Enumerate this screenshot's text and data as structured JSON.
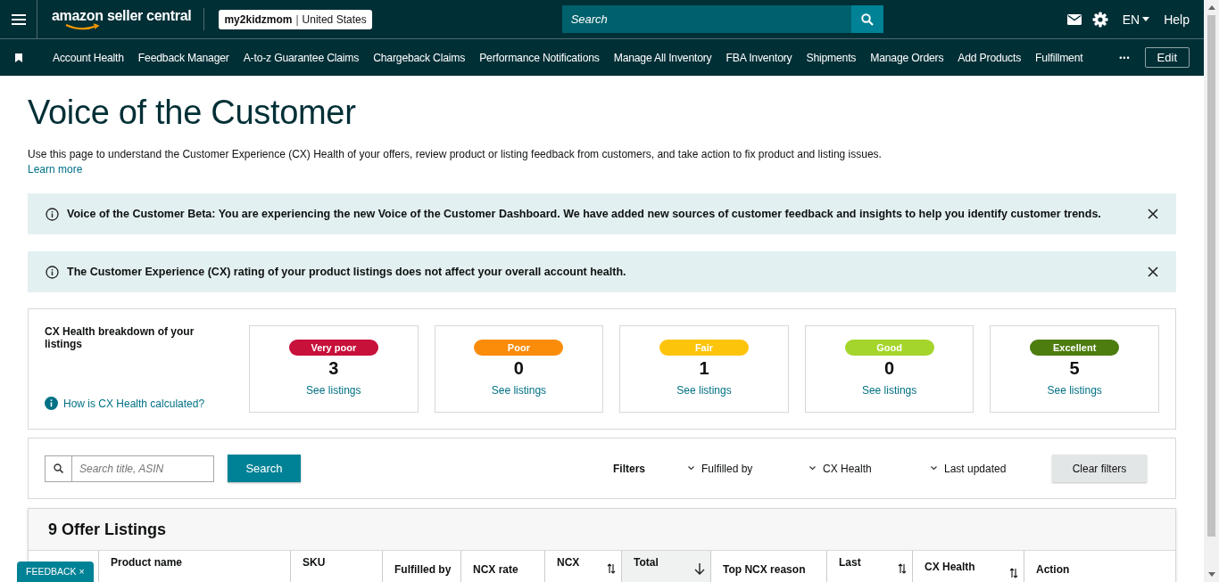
{
  "header": {
    "brand": "amazon seller central",
    "store": {
      "name": "my2kidzmom",
      "separator": "|",
      "region": "United States"
    },
    "search": {
      "placeholder": "Search"
    },
    "language": "EN",
    "help": "Help"
  },
  "nav": {
    "items": [
      "Account Health",
      "Feedback Manager",
      "A-to-z Guarantee Claims",
      "Chargeback Claims",
      "Performance Notifications",
      "Manage All Inventory",
      "FBA Inventory",
      "Shipments",
      "Manage Orders",
      "Add Products",
      "Fulfillment"
    ],
    "more": "•••",
    "edit": "Edit"
  },
  "page": {
    "title": "Voice of the Customer",
    "description": "Use this page to understand the Customer Experience (CX) Health of your offers, review product or listing feedback from customers, and take action to fix product and listing issues.",
    "learn_more": "Learn more"
  },
  "alerts": [
    {
      "text": "Voice of the Customer Beta: You are experiencing the new Voice of the Customer Dashboard. We have added new sources of customer feedback and insights to help you identify customer trends."
    },
    {
      "text": "The Customer Experience (CX) rating of your product listings does not affect your overall account health."
    }
  ],
  "breakdown": {
    "title": "CX Health breakdown of your listings",
    "help_link": "How is CX Health calculated?",
    "tiles": [
      {
        "label": "Very poor",
        "color": "#c7103a",
        "count": "3",
        "link": "See listings"
      },
      {
        "label": "Poor",
        "color": "#fa8c0a",
        "count": "0",
        "link": "See listings"
      },
      {
        "label": "Fair",
        "color": "#fdc40c",
        "count": "1",
        "link": "See listings"
      },
      {
        "label": "Good",
        "color": "#a4d52b",
        "count": "0",
        "link": "See listings"
      },
      {
        "label": "Excellent",
        "color": "#4d7c0f",
        "count": "5",
        "link": "See listings"
      }
    ]
  },
  "filters": {
    "search": {
      "placeholder": "Search title, ASIN"
    },
    "search_button": "Search",
    "label": "Filters",
    "dropdowns": [
      "Fulfilled by",
      "CX Health",
      "Last updated"
    ],
    "clear": "Clear filters"
  },
  "table": {
    "title": "9 Offer Listings",
    "columns": [
      {
        "label": "Product name",
        "sortable": false,
        "sorted": false
      },
      {
        "label": "SKU",
        "sortable": false,
        "sorted": false
      },
      {
        "label": "Fulfilled by",
        "sortable": false,
        "sorted": false
      },
      {
        "label": "NCX rate",
        "sortable": false,
        "sorted": false
      },
      {
        "label": "NCX",
        "sortable": true,
        "sorted": false
      },
      {
        "label": "Total",
        "sortable": true,
        "sorted": true
      },
      {
        "label": "Top NCX reason",
        "sortable": false,
        "sorted": false
      },
      {
        "label": "Last",
        "sortable": true,
        "sorted": false
      },
      {
        "label": "CX Health",
        "sortable": true,
        "sorted": false
      },
      {
        "label": "Action",
        "sortable": false,
        "sorted": false
      }
    ]
  },
  "feedback_tab": {
    "label": "FEEDBACK",
    "close": "×"
  }
}
